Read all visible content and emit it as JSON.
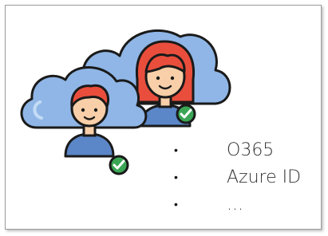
{
  "bullets": [
    {
      "label": "O365"
    },
    {
      "label": "Azure ID"
    },
    {
      "label": "..."
    }
  ],
  "bullet_glyph": "•",
  "illustration": {
    "icon": "cloud-users-verified-icon",
    "colors": {
      "cloud": "#8fb6e6",
      "outline": "#1a1a1a",
      "hair": "#e94e3c",
      "skin": "#f8cfa8",
      "shirt": "#5b86c8",
      "check": "#3aa655"
    }
  }
}
